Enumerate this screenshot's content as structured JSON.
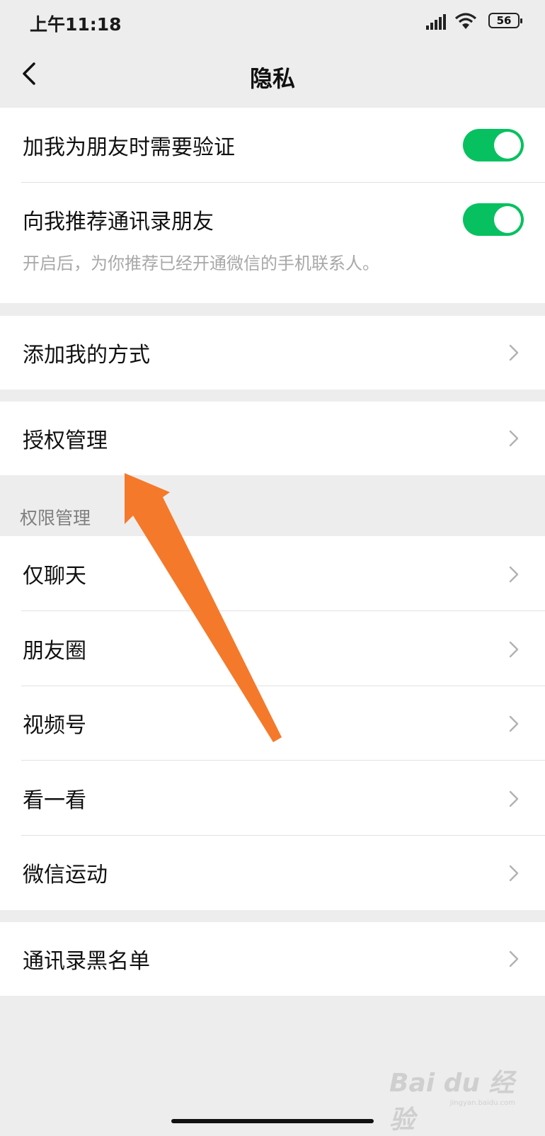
{
  "status_bar": {
    "time": "上午11:18",
    "battery": "56"
  },
  "nav": {
    "title": "隐私"
  },
  "verification_group": {
    "items": [
      {
        "label": "加我为朋友时需要验证",
        "enabled": true
      },
      {
        "label": "向我推荐通讯录朋友",
        "enabled": true,
        "hint": "开启后，为你推荐已经开通微信的手机联系人。"
      }
    ]
  },
  "add_me": {
    "label": "添加我的方式"
  },
  "auth": {
    "label": "授权管理"
  },
  "permissions": {
    "header": "权限管理",
    "items": [
      {
        "label": "仅聊天"
      },
      {
        "label": "朋友圈"
      },
      {
        "label": "视频号"
      },
      {
        "label": "看一看"
      },
      {
        "label": "微信运动"
      }
    ]
  },
  "blacklist": {
    "label": "通讯录黑名单"
  },
  "annotation": {
    "color": "#f5792a"
  },
  "watermark": {
    "text": "Bai du 经验",
    "sub": "jingyan.baidu.com"
  },
  "colors": {
    "toggle_on": "#07c160",
    "background": "#ededed"
  }
}
